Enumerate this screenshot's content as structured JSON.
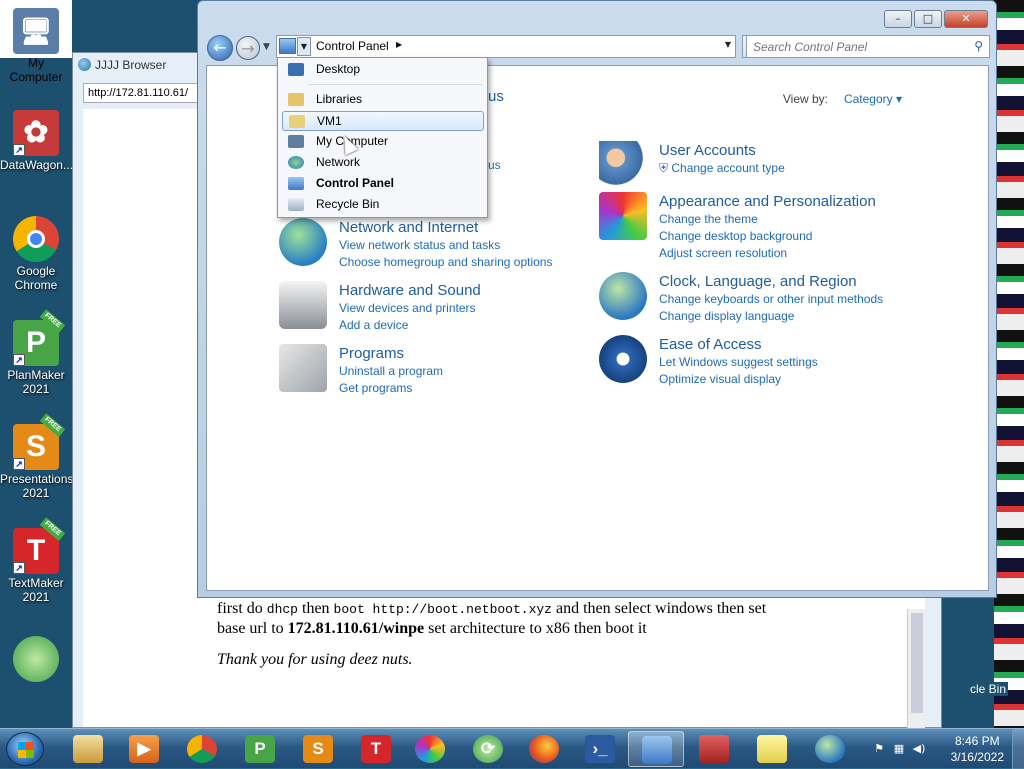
{
  "desktop": {
    "icons": [
      {
        "label": "My Computer",
        "glyph": "🖥",
        "color": "#5a7ea8"
      },
      {
        "label": "DataWagon...",
        "glyph": "✿",
        "color": "#c73a3a"
      },
      {
        "label": "Google Chrome",
        "glyph": "",
        "color": "chrome"
      },
      {
        "label": "PlanMaker 2021",
        "glyph": "P",
        "color": "#47a447"
      },
      {
        "label": "Presentations 2021",
        "glyph": "S",
        "color": "#e58a17"
      },
      {
        "label": "TextMaker 2021",
        "glyph": "T",
        "color": "#d5262b"
      }
    ],
    "free_badge": "FREE",
    "recycle_label": "cle Bin"
  },
  "browser": {
    "title": "JJJJ Browser",
    "address": "http://172.81.110.61/",
    "page": {
      "p1_a": "first do",
      "p1_code1": "dhcp",
      "p1_b": "then",
      "p1_code2": "boot http://boot.netboot.xyz",
      "p1_c": "and then select windows then set base url to",
      "p1_bold": "172.81.110.61/winpe",
      "p1_d": "set architecture to x86 then boot it",
      "thanks": "Thank you for using deez nuts."
    }
  },
  "control_panel": {
    "address_crumb": "Control Panel",
    "search_placeholder": "Search Control Panel",
    "view_by_label": "View by:",
    "view_by_value": "Category ▾",
    "hidden_heading_fragment": "us",
    "hidden_link_fragment": "us",
    "categories": [
      {
        "title": "Network and Internet",
        "links": [
          "View network status and tasks",
          "Choose homegroup and sharing options"
        ]
      },
      {
        "title": "Hardware and Sound",
        "links": [
          "View devices and printers",
          "Add a device"
        ]
      },
      {
        "title": "Programs",
        "links": [
          "Uninstall a program",
          "Get programs"
        ]
      },
      {
        "title": "User Accounts",
        "links": [
          "Change account type"
        ]
      },
      {
        "title": "Appearance and Personalization",
        "links": [
          "Change the theme",
          "Change desktop background",
          "Adjust screen resolution"
        ]
      },
      {
        "title": "Clock, Language, and Region",
        "links": [
          "Change keyboards or other input methods",
          "Change display language"
        ]
      },
      {
        "title": "Ease of Access",
        "links": [
          "Let Windows suggest settings",
          "Optimize visual display"
        ]
      }
    ]
  },
  "dropdown": {
    "items": [
      {
        "label": "Desktop",
        "icon": "desktop-icon"
      },
      {
        "label": "Libraries",
        "icon": "libraries-icon"
      },
      {
        "label": "VM1",
        "icon": "user-folder-icon",
        "selected": true
      },
      {
        "label": "My Computer",
        "icon": "computer-icon"
      },
      {
        "label": "Network",
        "icon": "network-icon"
      },
      {
        "label": "Control Panel",
        "icon": "control-panel-icon",
        "bold": true
      },
      {
        "label": "Recycle Bin",
        "icon": "recycle-bin-icon"
      }
    ]
  },
  "taskbar": {
    "clock_time": "8:46 PM",
    "clock_date": "3/16/2022"
  }
}
